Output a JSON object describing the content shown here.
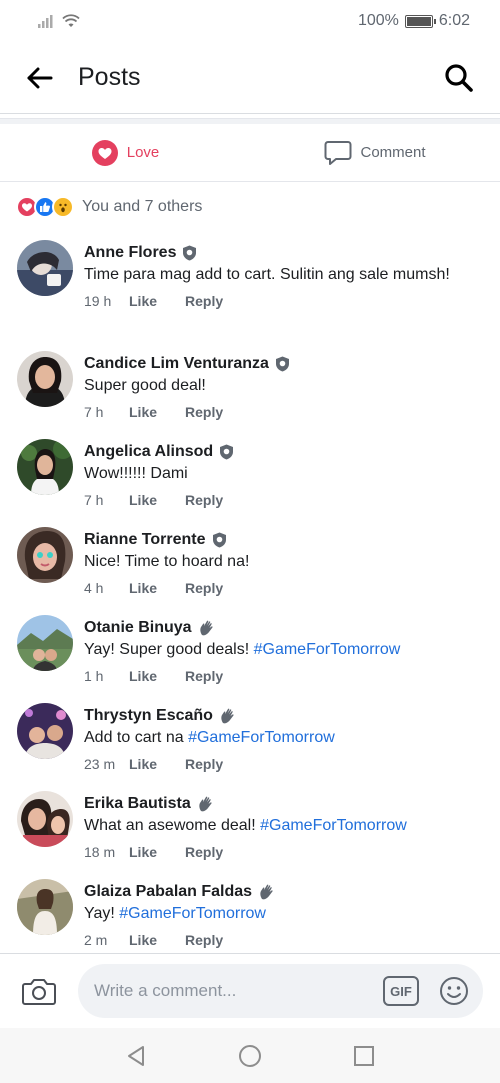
{
  "status_bar": {
    "battery": "100%",
    "battery_level": 1.0,
    "time": "6:02"
  },
  "header": {
    "title": "Posts"
  },
  "actions": {
    "love_label": "Love",
    "comment_label": "Comment"
  },
  "reactions": {
    "summary": "You and 7 others",
    "icons": [
      "love",
      "like",
      "wow"
    ]
  },
  "comments": [
    {
      "author": "Anne Flores",
      "badge": "shield-icon",
      "text": "Time para mag add to cart. Sulitin ang sale mumsh!",
      "hashtag": "",
      "time": "19 h"
    },
    {
      "author": "Candice Lim Venturanza",
      "badge": "shield-icon",
      "text": "Super good deal!",
      "hashtag": "",
      "time": "7 h"
    },
    {
      "author": "Angelica Alinsod",
      "badge": "shield-icon",
      "text": "Wow!!!!!! Dami",
      "hashtag": "",
      "time": "7 h"
    },
    {
      "author": "Rianne Torrente",
      "badge": "shield-icon",
      "text": "Nice! Time to hoard na!",
      "hashtag": "",
      "time": "4 h"
    },
    {
      "author": "Otanie Binuya",
      "badge": "wave-icon",
      "text": "Yay! Super good deals!",
      "hashtag": "#GameForTomorrow",
      "time": "1 h"
    },
    {
      "author": "Thrystyn Escaño",
      "badge": "wave-icon",
      "text": "Add to cart na",
      "hashtag": "#GameForTomorrow",
      "time": "23 m"
    },
    {
      "author": "Erika Bautista",
      "badge": "wave-icon",
      "text": "What an asewome deal!",
      "hashtag": "#GameForTomorrow",
      "time": "18 m"
    },
    {
      "author": "Glaiza Pabalan Faldas",
      "badge": "wave-icon",
      "text": "Yay!",
      "hashtag": "#GameForTomorrow",
      "time": "2 m"
    }
  ],
  "comment_actions": {
    "like": "Like",
    "reply": "Reply"
  },
  "composer": {
    "placeholder": "Write a comment...",
    "gif_label": "GIF"
  },
  "colors": {
    "love": "#e4405f",
    "like": "#1877f2",
    "wow": "#f7b928",
    "hashtag": "#216fdb"
  }
}
